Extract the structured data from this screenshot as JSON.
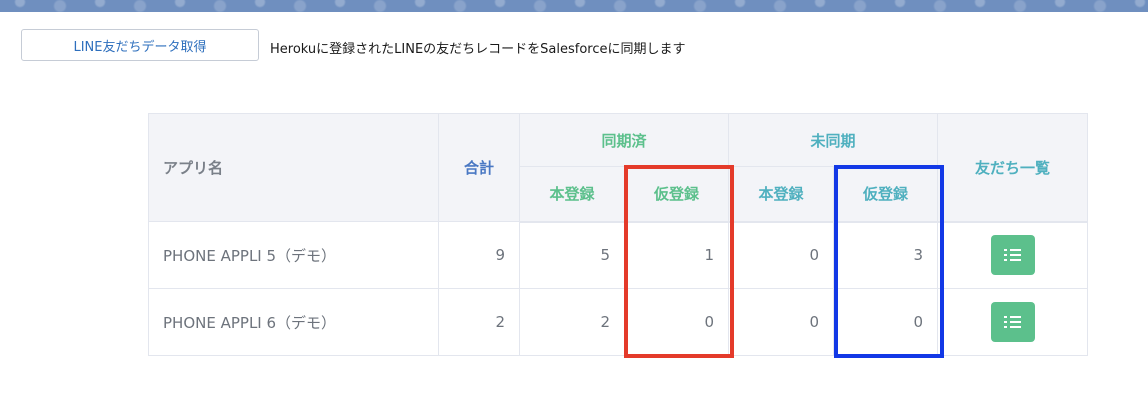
{
  "header": {
    "sync_button_label": "LINE友だちデータ取得",
    "description": "Herokuに登録されたLINEの友だちレコードをSalesforceに同期します"
  },
  "table": {
    "columns": {
      "app_name": "アプリ名",
      "total": "合計",
      "synced_group": "同期済",
      "unsynced_group": "未同期",
      "friends_list": "友だち一覧",
      "synced_registered": "本登録",
      "synced_provisional": "仮登録",
      "unsynced_registered": "本登録",
      "unsynced_provisional": "仮登録"
    },
    "rows": [
      {
        "name": "PHONE APPLI 5（デモ）",
        "total": "9",
        "synced_registered": "5",
        "synced_provisional": "1",
        "unsynced_registered": "0",
        "unsynced_provisional": "3"
      },
      {
        "name": "PHONE APPLI 6（デモ）",
        "total": "2",
        "synced_registered": "2",
        "synced_provisional": "0",
        "unsynced_registered": "0",
        "unsynced_provisional": "0"
      }
    ]
  },
  "icons": {
    "friends_list_button": "list-icon"
  },
  "colors": {
    "banner": "#6f8fbf",
    "total_header": "#4a78c3",
    "synced_header": "#5cc08c",
    "unsynced_header": "#4fb0bf",
    "action_button": "#5cc08c",
    "highlight_red": "#e43a2a",
    "highlight_blue": "#1238e6"
  }
}
